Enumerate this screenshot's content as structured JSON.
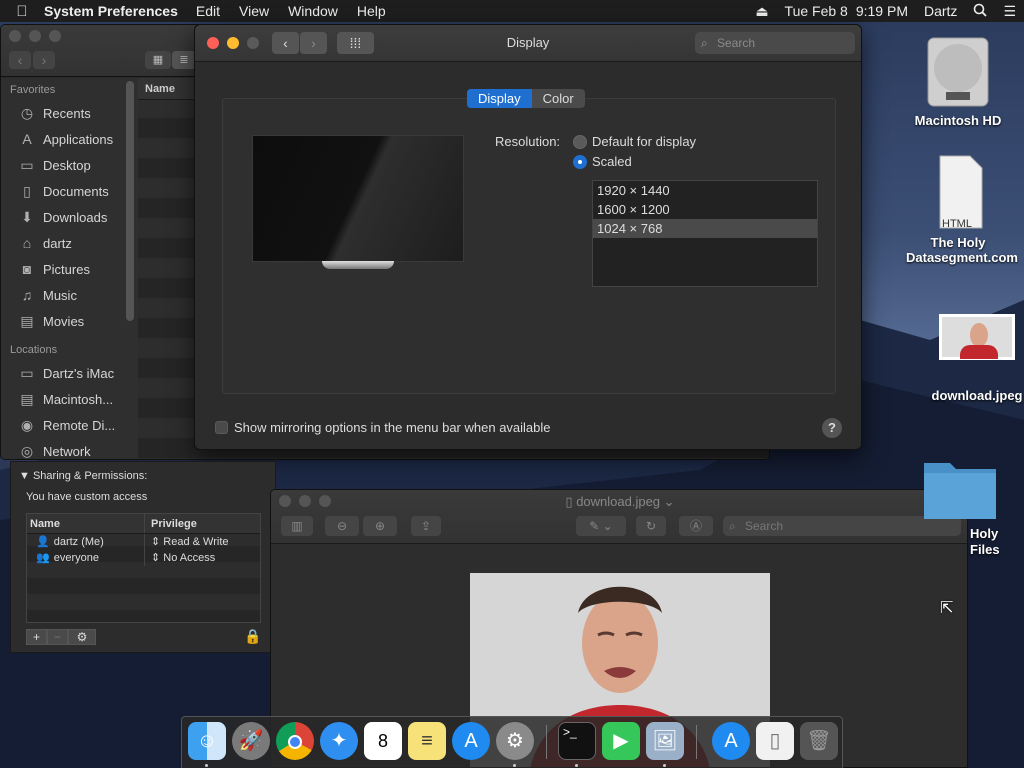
{
  "menubar": {
    "apple": "",
    "app_name": "System Preferences",
    "menus": [
      "Edit",
      "View",
      "Window",
      "Help"
    ],
    "date": "Tue Feb 8",
    "time": "9:19 PM",
    "user": "Dartz"
  },
  "finder": {
    "column_header": "Name",
    "favorites_label": "Favorites",
    "favorites": [
      "Recents",
      "Applications",
      "Desktop",
      "Documents",
      "Downloads",
      "dartz",
      "Pictures",
      "Music",
      "Movies"
    ],
    "locations_label": "Locations",
    "locations": [
      "Dartz's iMac",
      "Macintosh...",
      "Remote Di...",
      "Network"
    ]
  },
  "prefs": {
    "title": "Display",
    "search_placeholder": "Search",
    "tabs": [
      "Display",
      "Color"
    ],
    "active_tab": "Display",
    "resolution_label": "Resolution:",
    "options": [
      "Default for display",
      "Scaled"
    ],
    "selected_option": "Scaled",
    "resolutions": [
      "1920 × 1440",
      "1600 × 1200",
      "1024 × 768"
    ],
    "selected_resolution": "1024 × 768",
    "mirroring_label": "Show mirroring options in the menu bar when available",
    "help": "?"
  },
  "info": {
    "section_title": "Sharing & Permissions:",
    "access_text": "You have custom access",
    "col_name": "Name",
    "col_privilege": "Privilege",
    "rows": [
      {
        "name": "dartz (Me)",
        "privilege": "Read & Write"
      },
      {
        "name": "everyone",
        "privilege": "No Access"
      }
    ],
    "add": "+",
    "remove": "−",
    "gear": "⚙"
  },
  "preview": {
    "title": "download.jpeg",
    "search_placeholder": "Search"
  },
  "desktop": {
    "icons": [
      "Macintosh HD",
      "The Holy Datasegment.com",
      "download.jpeg",
      "Holy Files"
    ],
    "html_badge": "HTML"
  },
  "colors": {
    "accent": "#1f6fd1",
    "close": "#fe5f57",
    "minimize": "#febc2e",
    "zoom": "#28c840"
  }
}
